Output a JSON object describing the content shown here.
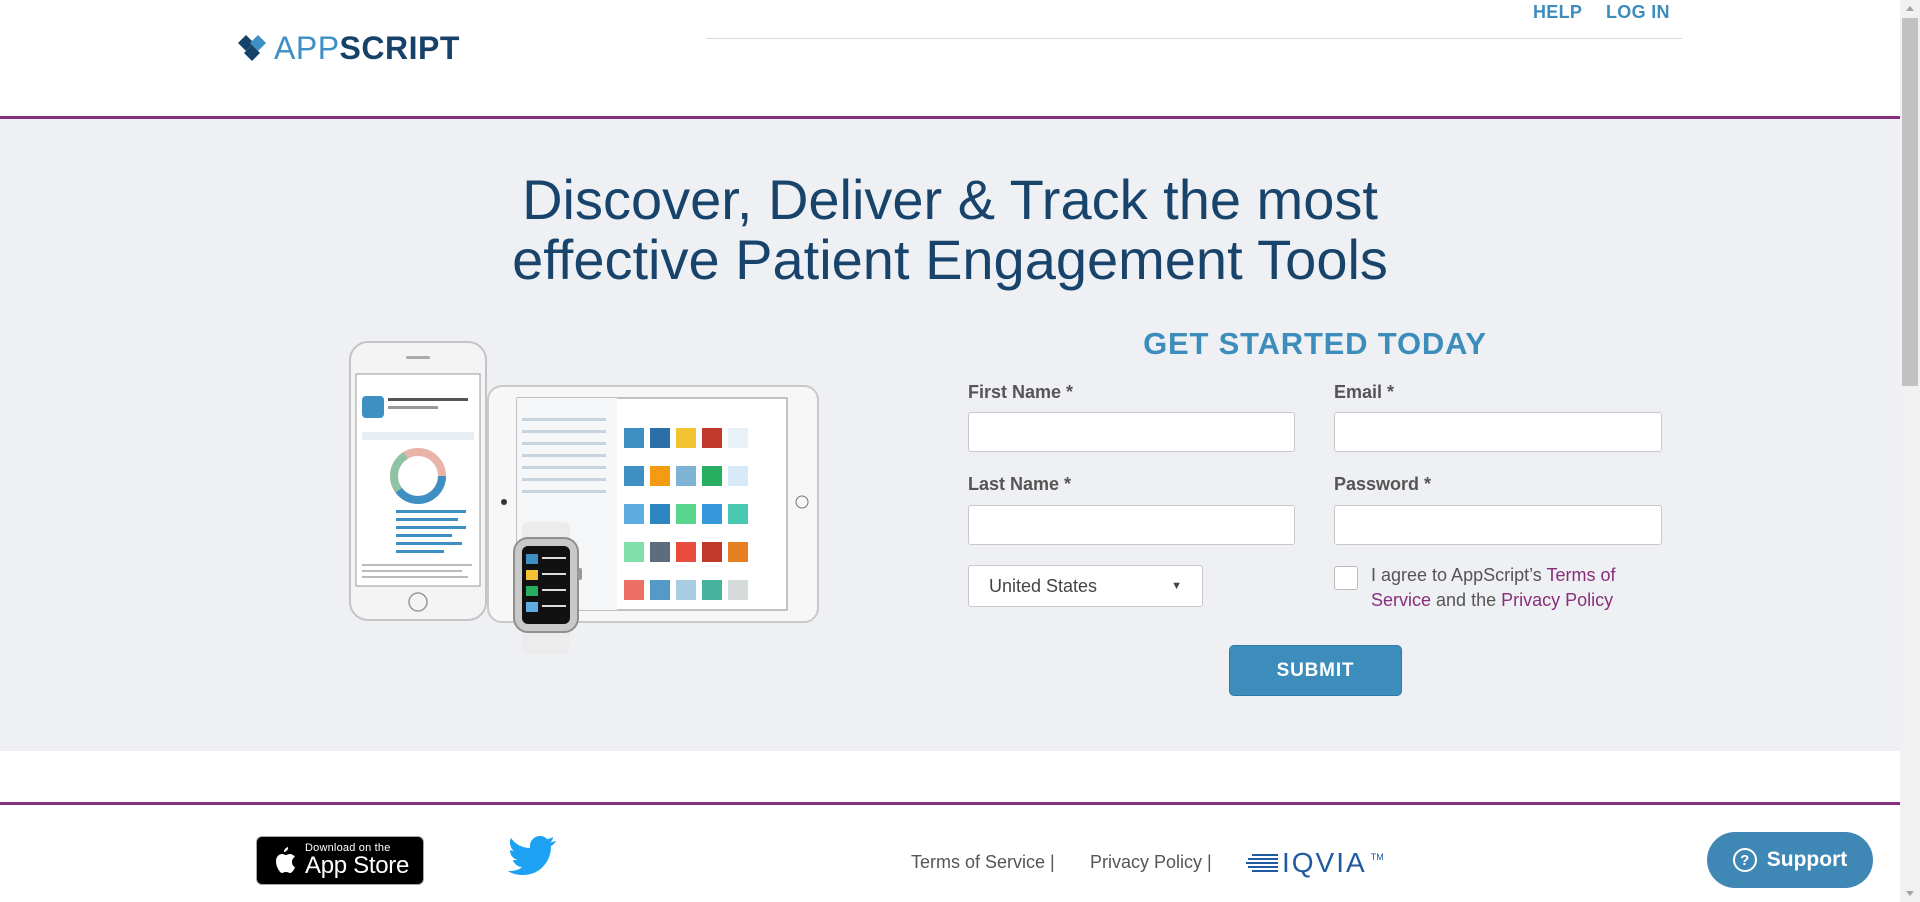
{
  "header": {
    "logo": {
      "app": "APP",
      "script": "SCRIPT"
    },
    "nav": {
      "help": "HELP",
      "login": "LOG IN"
    }
  },
  "hero": {
    "headline_line1": "Discover, Deliver & Track the most",
    "headline_line2": "effective Patient Engagement Tools"
  },
  "form": {
    "title": "GET STARTED TODAY",
    "first_name_label": "First Name *",
    "first_name_value": "",
    "email_label": "Email *",
    "email_value": "",
    "last_name_label": "Last Name *",
    "last_name_value": "",
    "password_label": "Password *",
    "password_value": "",
    "country_value": "United States",
    "agree_prefix": "I agree to AppScript’s ",
    "terms_link": "Terms of Service",
    "agree_middle": " and the ",
    "privacy_link": "Privacy Policy",
    "agree_checked": false,
    "submit_label": "SUBMIT"
  },
  "footer": {
    "appstore_small": "Download on the",
    "appstore_big": "App Store",
    "terms": "Terms of Service |",
    "privacy": "Privacy Policy |",
    "iqvia": "IQVIA",
    "iqvia_tm": "TM"
  },
  "support": {
    "label": "Support",
    "icon_text": "?"
  },
  "colors": {
    "brand_blue": "#3c8dbc",
    "navy": "#18446c",
    "purple": "#862f7c",
    "hero_bg": "#eef0f3"
  }
}
